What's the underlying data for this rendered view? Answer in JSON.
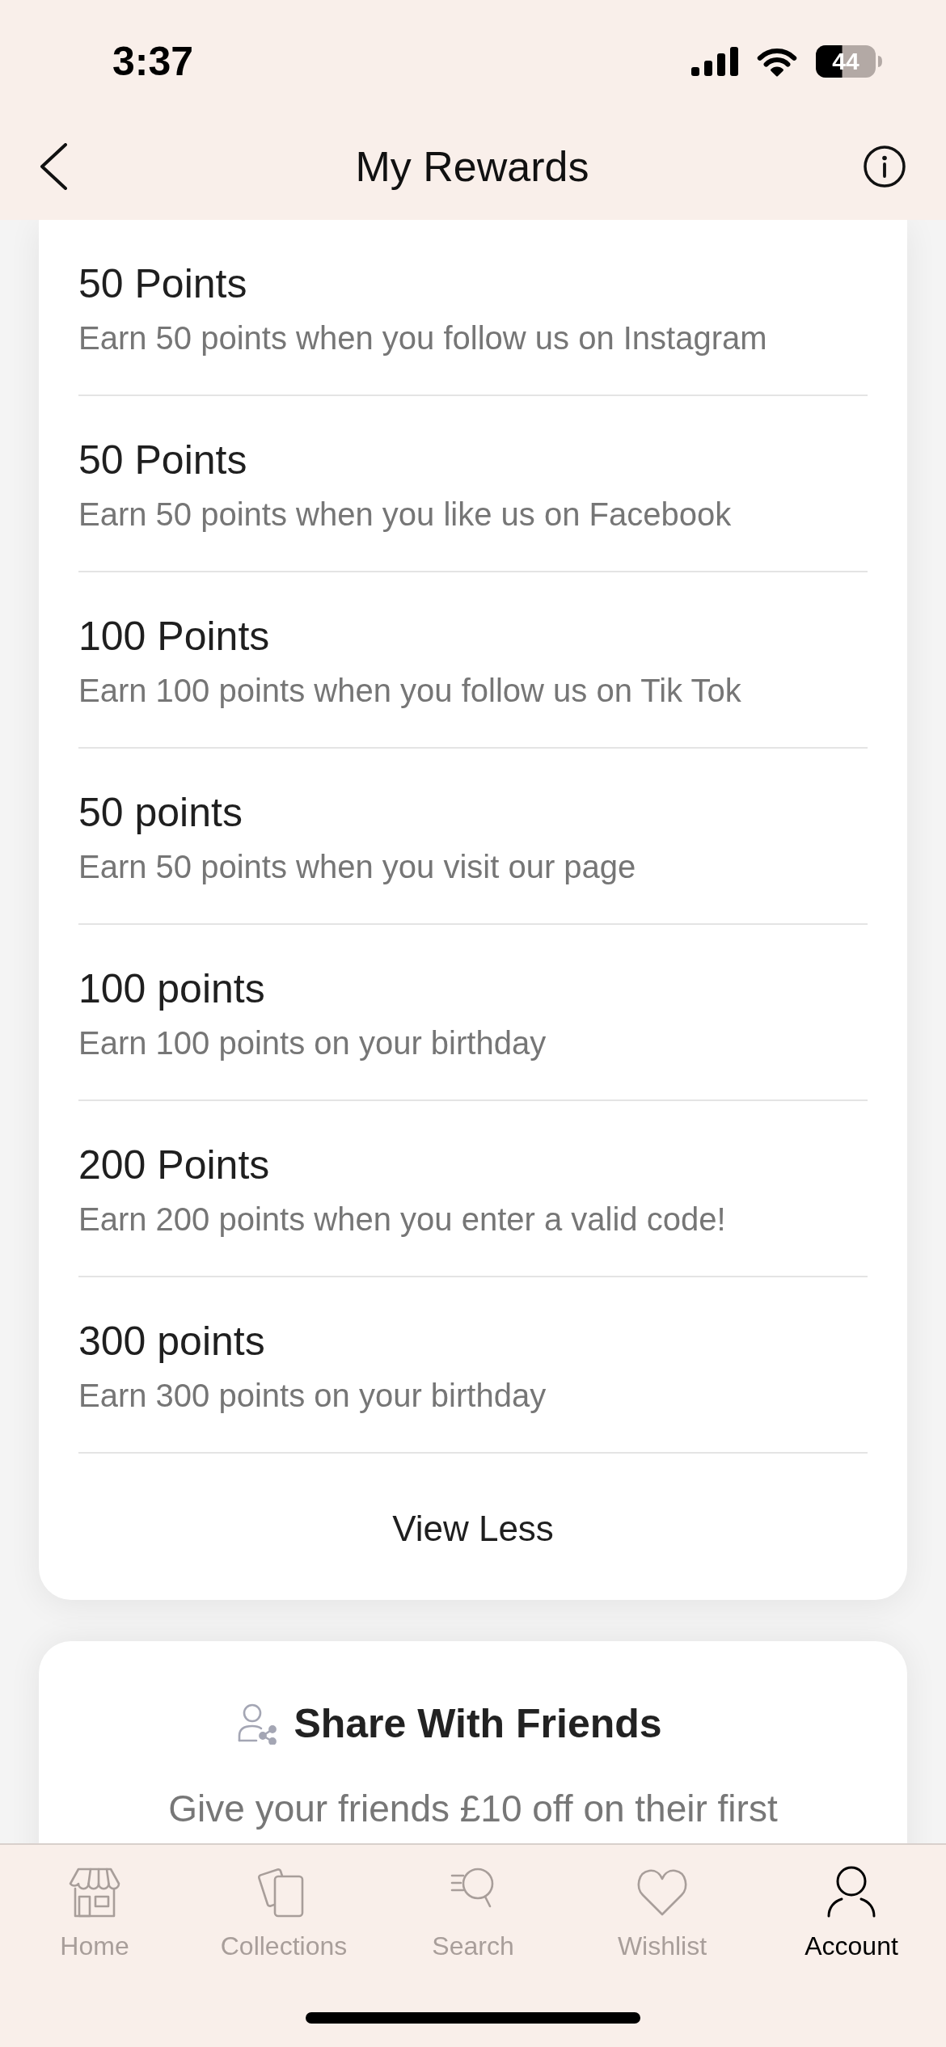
{
  "status_bar": {
    "time": "3:37",
    "battery": "44"
  },
  "header": {
    "title": "My Rewards"
  },
  "rewards": {
    "items": [
      {
        "title": "50 Points",
        "description": "Earn 50 points when you follow us on Instagram"
      },
      {
        "title": "50 Points",
        "description": "Earn 50 points when you like us on Facebook"
      },
      {
        "title": "100 Points",
        "description": "Earn 100 points when you follow us on Tik Tok"
      },
      {
        "title": "50 points",
        "description": "Earn 50 points when you visit our page"
      },
      {
        "title": "100 points",
        "description": "Earn 100 points on your birthday"
      },
      {
        "title": "200 Points",
        "description": "Earn 200 points when you enter a valid code!"
      },
      {
        "title": "300 points",
        "description": "Earn 300 points on your birthday"
      }
    ],
    "toggle": "View Less"
  },
  "share": {
    "title": "Share With Friends",
    "text": "Give your friends £10 off on their first"
  },
  "tab_bar": [
    {
      "label": "Home",
      "selected": false
    },
    {
      "label": "Collections",
      "selected": false
    },
    {
      "label": "Search",
      "selected": false
    },
    {
      "label": "Wishlist",
      "selected": false
    },
    {
      "label": "Account",
      "selected": true
    }
  ]
}
